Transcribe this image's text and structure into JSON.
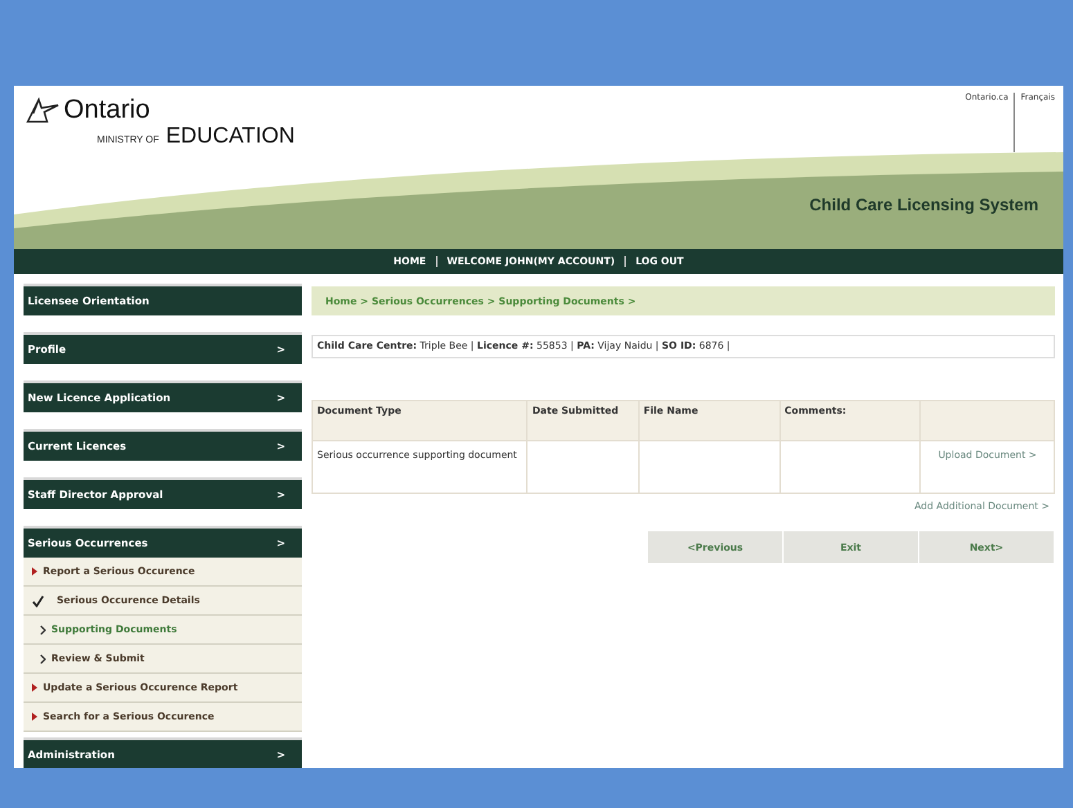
{
  "header": {
    "logo_text": "Ontario",
    "ministry_prefix": "MINISTRY OF",
    "ministry": "EDUCATION",
    "top_links": [
      "Ontario.ca",
      "Français"
    ],
    "system_title": "Child Care Licensing System"
  },
  "nav": [
    "HOME",
    "WELCOME JOHN(MY ACCOUNT)",
    "LOG OUT"
  ],
  "sidebar": {
    "items": [
      {
        "label": "Licensee Orientation"
      },
      {
        "label": "Profile",
        "arrow": ">"
      },
      {
        "label": "New Licence Application",
        "arrow": ">"
      },
      {
        "label": "Current Licences",
        "arrow": ">"
      },
      {
        "label": "Staff Director Approval",
        "arrow": ">"
      },
      {
        "label": "Serious Occurrences",
        "arrow": ">",
        "children": [
          {
            "label": "Report a Serious Occurence",
            "kind": "bullet",
            "selected": false
          },
          {
            "label": "Serious Occurence Details",
            "kind": "check",
            "selected": false
          },
          {
            "label": "Supporting Documents",
            "kind": "step",
            "selected": true
          },
          {
            "label": "Review & Submit",
            "kind": "step",
            "selected": false
          },
          {
            "label": "Update a Serious Occurence Report",
            "kind": "bullet",
            "selected": false
          },
          {
            "label": "Search for a Serious Occurence",
            "kind": "bullet",
            "selected": false
          }
        ]
      },
      {
        "label": "Administration",
        "arrow": ">"
      }
    ]
  },
  "breadcrumb": "Home > Serious Occurrences > Supporting Documents >",
  "info_line": "**Child Care Centre:** Triple Bee | **Licence #:** 55853 | **PA:** Vijay Naidu | **SO ID:** 6876 |",
  "table": {
    "columns": [
      "Document Type",
      "Date Submitted",
      "File Name",
      "Comments:"
    ],
    "rows": [
      {
        "document_type": "Serious occurrence supporting document",
        "action": "Upload Document >"
      }
    ]
  },
  "add_link": "Add Additional Document >",
  "buttons": [
    "<Previous",
    "Exit",
    "Next>"
  ]
}
